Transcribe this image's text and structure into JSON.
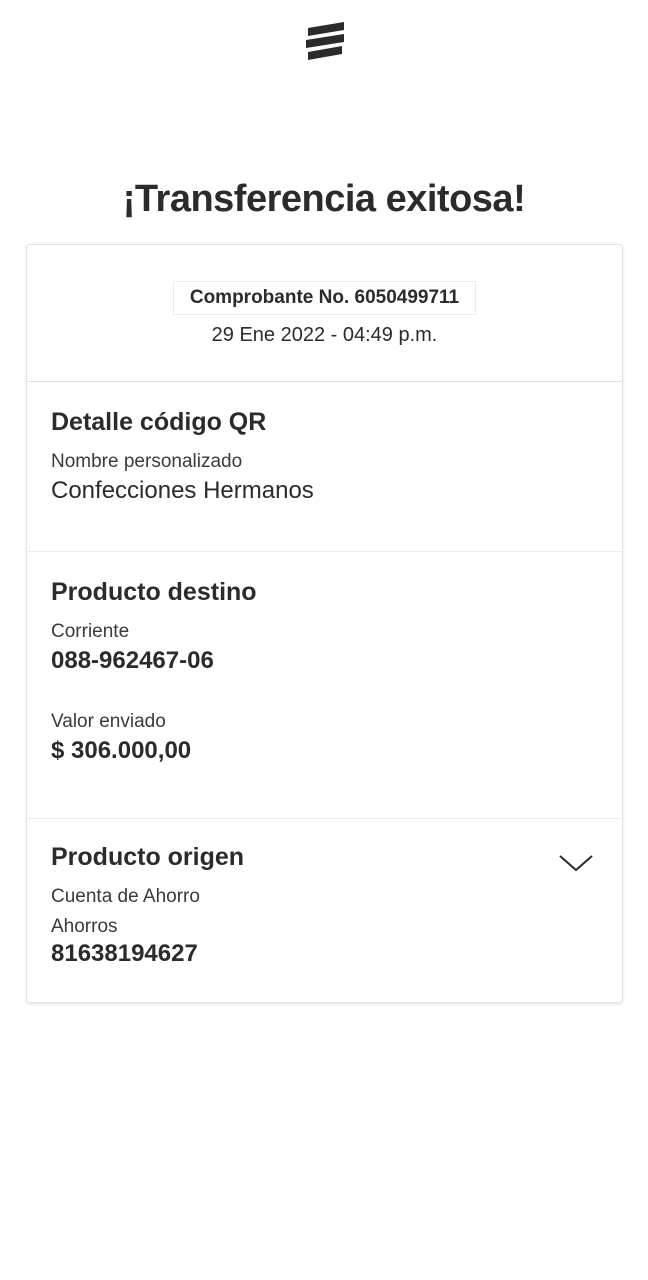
{
  "header": {
    "logo_icon": "bank-logo-icon",
    "title": "¡Transferencia exitosa!"
  },
  "receipt": {
    "voucher": "Comprobante No. 6050499711",
    "date": "29 Ene 2022 - 04:49 p.m."
  },
  "qr_detail": {
    "title": "Detalle código QR",
    "name_label": "Nombre personalizado",
    "name_value": "Confecciones Hermanos"
  },
  "destination": {
    "title": "Producto destino",
    "account_type": "Corriente",
    "account_number": "088-962467-06",
    "amount_label": "Valor enviado",
    "amount_value": "$ 306.000,00"
  },
  "origin": {
    "title": "Producto origen",
    "expand_icon": "chevron-down-icon",
    "account_type": "Cuenta de Ahorro",
    "account_subtype": "Ahorros",
    "account_number": "81638194627"
  },
  "colors": {
    "text": "#2b2b2b",
    "divider": "#e0e0e0"
  }
}
